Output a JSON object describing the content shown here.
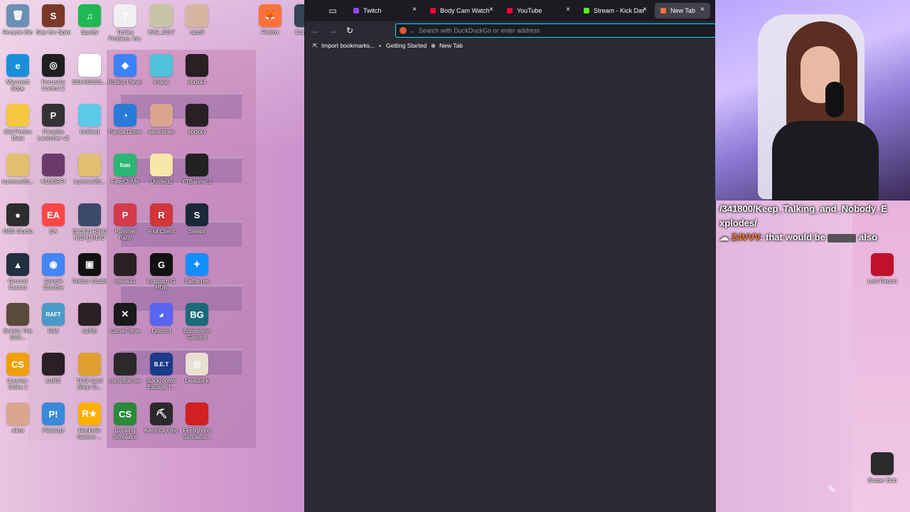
{
  "desktop": {
    "icons": [
      {
        "label": "Recycle Bin",
        "color": "#6b8fb5",
        "glyph": "🗑"
      },
      {
        "label": "Slay the Spire",
        "color": "#7a3a2a",
        "glyph": "S"
      },
      {
        "label": "Spotify",
        "color": "#1db954",
        "glyph": "♫"
      },
      {
        "label": "Trolley Problem, Inc.",
        "color": "#f0f0f0",
        "glyph": "T"
      },
      {
        "label": "IMG_8017",
        "color": "#c9c3a8",
        "glyph": ""
      },
      {
        "label": "njqn9",
        "color": "#d8b5a0",
        "glyph": ""
      },
      {
        "label": "Microsoft Edge",
        "color": "#1a8fd9",
        "glyph": "e"
      },
      {
        "label": "Focusrite Control 2",
        "color": "#1f1f1f",
        "glyph": "◎"
      },
      {
        "label": "563-563251...",
        "color": "#ffffff",
        "glyph": "○"
      },
      {
        "label": "Roblox Player",
        "color": "#3b82f6",
        "glyph": "◆"
      },
      {
        "label": "image",
        "color": "#4ec3d9",
        "glyph": ""
      },
      {
        "label": "ybdxk4",
        "color": "#2a1f24",
        "glyph": ""
      },
      {
        "label": "Old Firefox Data",
        "color": "#f5c842",
        "glyph": ""
      },
      {
        "label": "Paradox Launcher v2",
        "color": "#333333",
        "glyph": "P"
      },
      {
        "label": "Untitled",
        "color": "#5cc9e8",
        "glyph": ""
      },
      {
        "label": "Panda Dome",
        "color": "#2a7bd9",
        "glyph": "◔"
      },
      {
        "label": "aikobitrate",
        "color": "#d9a58f",
        "glyph": ""
      },
      {
        "label": "ybdxk4",
        "color": "#2a1f24",
        "glyph": ""
      },
      {
        "label": "summer20...",
        "color": "#e0c070",
        "glyph": ""
      },
      {
        "label": "KU3BRFI",
        "color": "#6b3a6b",
        "glyph": ""
      },
      {
        "label": "summer20...",
        "color": "#e0c070",
        "glyph": ""
      },
      {
        "label": "FilterOnMe",
        "color": "#2bb673",
        "glyph": "fom"
      },
      {
        "label": "Untitled2",
        "color": "#f5e8a8",
        "glyph": ""
      },
      {
        "label": "YTBanner 2",
        "color": "#222222",
        "glyph": ""
      },
      {
        "label": "OBS Studio",
        "color": "#2d2d2d",
        "glyph": "●"
      },
      {
        "label": "EA",
        "color": "#ff4747",
        "glyph": "EA"
      },
      {
        "label": "ELDEN RING NIGHTREIGN",
        "color": "#3a4a6a",
        "glyph": ""
      },
      {
        "label": "Pummel Party",
        "color": "#d43a4a",
        "glyph": "P"
      },
      {
        "label": "Riot Client",
        "color": "#d13639",
        "glyph": "R"
      },
      {
        "label": "Steam",
        "color": "#1b2838",
        "glyph": "S"
      },
      {
        "label": "Ground Control",
        "color": "#203040",
        "glyph": "▲"
      },
      {
        "label": "Google Chrome",
        "color": "#4285f4",
        "glyph": "◉"
      },
      {
        "label": "Roblox Studio",
        "color": "#111111",
        "glyph": "▣"
      },
      {
        "label": "ybdxk41",
        "color": "#2a1f24",
        "glyph": ""
      },
      {
        "label": "Logitech G HUB",
        "color": "#111111",
        "glyph": "G"
      },
      {
        "label": "Battle.net",
        "color": "#148eff",
        "glyph": "✦"
      },
      {
        "label": "Enkidu The Stoli...",
        "color": "#5a4a3a",
        "glyph": ""
      },
      {
        "label": "Raft",
        "color": "#4a9ac9",
        "glyph": "RAFT"
      },
      {
        "label": "sizRE",
        "color": "#2a1f24",
        "glyph": ""
      },
      {
        "label": "CurseForge",
        "color": "#1a1a1a",
        "glyph": "✕"
      },
      {
        "label": "Discord",
        "color": "#5865f2",
        "glyph": "◕"
      },
      {
        "label": "Borderless Gaming",
        "color": "#1a6a7a",
        "glyph": "BG"
      },
      {
        "label": "Counter-Strike 2",
        "color": "#f0a000",
        "glyph": "CS"
      },
      {
        "label": "sizRE",
        "color": "#2a1f24",
        "glyph": ""
      },
      {
        "label": "TCG Card Shop Si...",
        "color": "#e0a030",
        "glyph": ""
      },
      {
        "label": "compBanner",
        "color": "#2a2a2a",
        "glyph": ""
      },
      {
        "label": "Backrooms Escape T...",
        "color": "#1a3a8a",
        "glyph": "B.E.T"
      },
      {
        "label": "Deadlock",
        "color": "#e8e0d0",
        "glyph": "◎"
      },
      {
        "label": "aikot",
        "color": "#d9a58f",
        "glyph": ""
      },
      {
        "label": "PlateUp!",
        "color": "#3a8ad9",
        "glyph": "P!"
      },
      {
        "label": "Rockstar Games ...",
        "color": "#fcb000",
        "glyph": "R★"
      },
      {
        "label": "Cooking Simulator",
        "color": "#2a8a3a",
        "glyph": "CS"
      },
      {
        "label": "Keep Digging",
        "color": "#2a2a2a",
        "glyph": "⛏"
      },
      {
        "label": "Firefighting Simulator...",
        "color": "#d02020",
        "glyph": ""
      },
      {
        "label": "Firefox",
        "color": "#ff7139",
        "glyph": "🦊"
      },
      {
        "label": "Cont Po",
        "color": "#334455",
        "glyph": ""
      },
      {
        "label": "Last Report",
        "color": "#c0102a",
        "glyph": ""
      },
      {
        "label": "Burger Bob",
        "color": "#2a2a2a",
        "glyph": ""
      }
    ]
  },
  "browser": {
    "tabs": [
      {
        "label": "Twitch",
        "color": "#9146ff"
      },
      {
        "label": "Body Cam Watch - Y",
        "color": "#ff0033"
      },
      {
        "label": "YouTube",
        "color": "#ff0033"
      },
      {
        "label": "Stream - Kick Dashb",
        "color": "#53fc18"
      },
      {
        "label": "New Tab",
        "color": "#ff7139"
      }
    ],
    "close_glyph": "×",
    "nav": {
      "back": "←",
      "forward": "→",
      "reload": "↻"
    },
    "url": {
      "value": "",
      "placeholder": "Search with DuckDuckGo or enter address"
    },
    "bookmarks": [
      {
        "label": "Import bookmarks...",
        "icon": "⇱"
      },
      {
        "label": "Getting Started",
        "icon": "▪"
      },
      {
        "label": "New Tab",
        "icon": "⊕"
      }
    ]
  },
  "chat": {
    "line1": "/341800/Keep_Talking_and_Nobody_E",
    "line2": "xplodes/",
    "user": "Z4VVV",
    "message": ": that would be ",
    "suffix": "also"
  },
  "colors": {
    "browser_bg": "#2b2a33",
    "tabbar_bg": "#1c1b22",
    "url_focus": "#00ddff"
  }
}
